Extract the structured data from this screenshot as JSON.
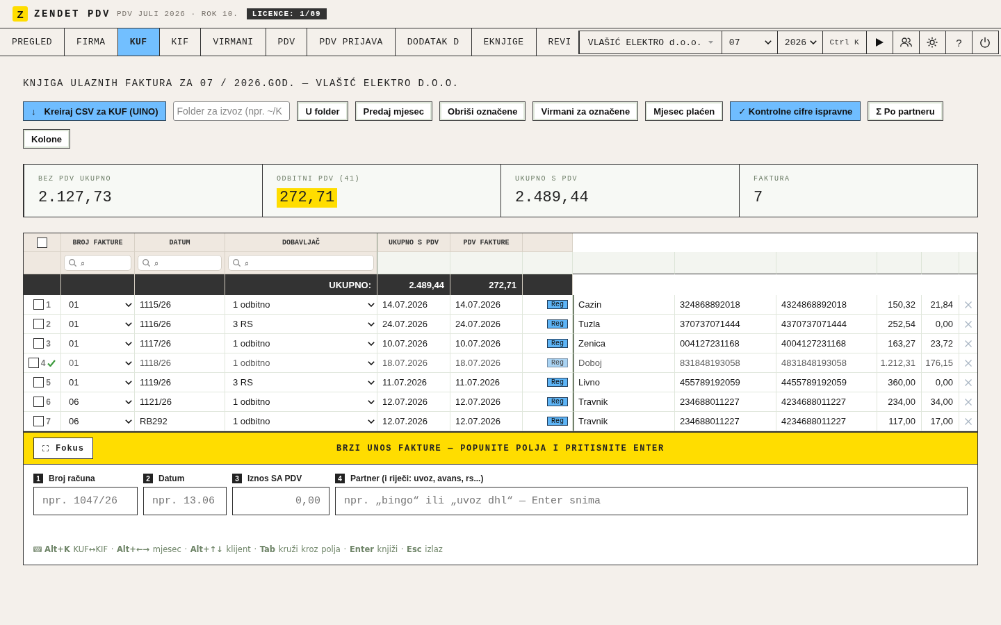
{
  "app": {
    "logo_letter": "Z",
    "name": "ZENDET PDV",
    "period": "PDV JULI 2026 · ROK 10.",
    "license": "LICENCE: 1/89"
  },
  "tabs": [
    {
      "label": "PREGLED",
      "selected": false
    },
    {
      "label": "FIRMA",
      "selected": false
    },
    {
      "label": "KUF",
      "selected": true
    },
    {
      "label": "KIF",
      "selected": false
    },
    {
      "label": "VIRMANI",
      "selected": false
    },
    {
      "label": "PDV",
      "selected": false
    },
    {
      "label": "PDV PRIJAVA",
      "selected": false
    },
    {
      "label": "DODATAK D",
      "selected": false
    },
    {
      "label": "EKNJIGE",
      "selected": false
    },
    {
      "label": "REVI",
      "selected": false
    }
  ],
  "toolbar": {
    "client": "VLAŠIĆ ELEKTRO d.o.o.",
    "month": "07",
    "year": "2026",
    "command_hint": "Ctrl K",
    "help": "?"
  },
  "page_title": "KNJIGA ULAZNIH FAKTURA ZA 07 / 2026.GOD. — VLAŠIĆ ELEKTRO D.O.O.",
  "actions": [
    {
      "kind": "button",
      "icon": "↓",
      "label": "Kreiraj CSV za KUF (UINO)",
      "highlighted": true
    },
    {
      "kind": "field",
      "placeholder": "Folder za izvoz (npr. ~/K"
    },
    {
      "kind": "button",
      "label": "U folder",
      "highlighted": false
    },
    {
      "kind": "button",
      "label": "Predaj mjesec",
      "highlighted": false
    },
    {
      "kind": "button",
      "label": "Obriši označene",
      "highlighted": false
    },
    {
      "kind": "button",
      "label": "Virmani za označene",
      "highlighted": false
    },
    {
      "kind": "button",
      "label": "Mjesec plaćen",
      "highlighted": false
    },
    {
      "kind": "button",
      "label": "✓ Kontrolne cifre ispravne",
      "highlighted": true
    },
    {
      "kind": "button",
      "label": "Σ Po partneru",
      "highlighted": false
    },
    {
      "kind": "button",
      "label": "Kolone",
      "highlighted": false
    }
  ],
  "summary": [
    {
      "label": "BEZ PDV UKUPNO",
      "value": "2.127,73",
      "highlighted": false
    },
    {
      "label": "ODBITNI PDV (41)",
      "value": "272,71",
      "highlighted": true
    },
    {
      "label": "UKUPNO S PDV",
      "value": "2.489,44",
      "highlighted": false
    },
    {
      "label": "FAKTURA",
      "value": "7",
      "highlighted": false
    }
  ],
  "table": {
    "select_all": {
      "checked": false
    },
    "columns": [
      "BROJ FAKTURE",
      "DATUM",
      "DOBAVLJAČ",
      "UKUPNO S PDV",
      "PDV FAKTURE"
    ],
    "filters": [
      {
        "placeholder": "⌕"
      },
      {
        "placeholder": "⌕"
      },
      {
        "placeholder": "⌕"
      }
    ],
    "totals": {
      "label": "UKUPNO:",
      "total_with_vat": "2.489,44",
      "vat": "272,71"
    },
    "rows": [
      {
        "number": "1",
        "checked": false,
        "confirmed": false,
        "column_2": "01",
        "column_3": "1115/26",
        "column_4": "1 odbitno",
        "column_5": "14.07.2026",
        "column_6": "14.07.2026",
        "column_7": "Reg",
        "column_8": "Cazin",
        "column_9": "324868892018",
        "column_10": "4324868892018",
        "column_11": "150,32",
        "column_12": "21,84"
      },
      {
        "number": "2",
        "checked": false,
        "confirmed": false,
        "column_2": "01",
        "column_3": "1116/26",
        "column_4": "3 RS",
        "column_5": "24.07.2026",
        "column_6": "24.07.2026",
        "column_7": "Reg",
        "column_8": "Tuzla",
        "column_9": "370737071444",
        "column_10": "4370737071444",
        "column_11": "252,54",
        "column_12": "0,00"
      },
      {
        "number": "3",
        "checked": false,
        "confirmed": false,
        "column_2": "01",
        "column_3": "1117/26",
        "column_4": "1 odbitno",
        "column_5": "10.07.2026",
        "column_6": "10.07.2026",
        "column_7": "Reg",
        "column_8": "Zenica",
        "column_9": "004127231168",
        "column_10": "4004127231168",
        "column_11": "163,27",
        "column_12": "23,72"
      },
      {
        "number": "4",
        "checked": false,
        "confirmed": true,
        "column_2": "01",
        "column_3": "1118/26",
        "column_4": "1 odbitno",
        "column_5": "18.07.2026",
        "column_6": "18.07.2026",
        "column_7": "Reg",
        "column_8": "Doboj",
        "column_9": "831848193058",
        "column_10": "4831848193058",
        "column_11": "1.212,31",
        "column_12": "176,15"
      },
      {
        "number": "5",
        "checked": false,
        "confirmed": false,
        "column_2": "01",
        "column_3": "1119/26",
        "column_4": "3 RS",
        "column_5": "11.07.2026",
        "column_6": "11.07.2026",
        "column_7": "Reg",
        "column_8": "Livno",
        "column_9": "455789192059",
        "column_10": "4455789192059",
        "column_11": "360,00",
        "column_12": "0,00"
      },
      {
        "number": "6",
        "checked": false,
        "confirmed": false,
        "column_2": "06",
        "column_3": "1121/26",
        "column_4": "1 odbitno",
        "column_5": "12.07.2026",
        "column_6": "12.07.2026",
        "column_7": "Reg",
        "column_8": "Travnik",
        "column_9": "234688011227",
        "column_10": "4234688011227",
        "column_11": "234,00",
        "column_12": "34,00"
      },
      {
        "number": "7",
        "checked": false,
        "confirmed": false,
        "column_2": "06",
        "column_3": "RB292",
        "column_4": "1 odbitno",
        "column_5": "12.07.2026",
        "column_6": "12.07.2026",
        "column_7": "Reg",
        "column_8": "Travnik",
        "column_9": "234688011227",
        "column_10": "4234688011227",
        "column_11": "117,00",
        "column_12": "17,00"
      }
    ]
  },
  "quick_entry": {
    "focus_button": "Fokus",
    "banner": "BRZI UNOS FAKTURE — POPUNITE POLJA I PRITISNITE ENTER",
    "fields": [
      {
        "number": "1",
        "label": "Broj računa",
        "kind": "text",
        "placeholder": "npr. 1047/26"
      },
      {
        "number": "2",
        "label": "Datum",
        "kind": "text",
        "placeholder": "npr. 13.06"
      },
      {
        "number": "3",
        "label": "Iznos SA PDV",
        "kind": "amount",
        "placeholder": "0,00"
      },
      {
        "number": "4",
        "label": "Partner (i riječi: uvoz, avans, rs...)",
        "kind": "text",
        "placeholder": "npr. „bingo“ ili „uvoz dhl“ — Enter snima"
      }
    ],
    "hints": "**Alt+K** KUF↔KIF · **Alt+←→** mjesec · **Alt+↑↓** klijent · **Tab** kruži kroz polja · **Enter** knjiži · **Esc** izlaz"
  }
}
